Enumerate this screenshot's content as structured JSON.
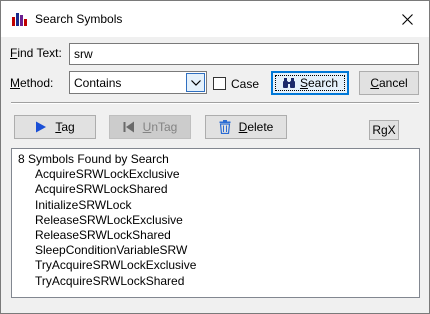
{
  "window": {
    "title": "Search Symbols",
    "app_icon": "bar-chart-icon",
    "close_icon": "close-icon"
  },
  "find": {
    "label_u": "F",
    "label_rest": "ind Text:",
    "value": "srw"
  },
  "method": {
    "label_u": "M",
    "label_rest": "ethod:",
    "selected": "Contains",
    "dropdown_icon": "chevron-down-icon"
  },
  "case_checkbox": {
    "label": "Case",
    "checked": false
  },
  "search_button": {
    "label_u": "S",
    "label_rest": "earch",
    "icon": "binoculars-icon"
  },
  "cancel_button": {
    "label_u": "C",
    "label_rest": "ancel"
  },
  "tag_button": {
    "label_u": "T",
    "label_rest": "ag",
    "icon": "play-arrow-icon"
  },
  "untag_button": {
    "label_u": "U",
    "label_rest": "nTag",
    "icon": "back-arrow-icon",
    "enabled": false
  },
  "delete_button": {
    "label_u": "D",
    "label_rest": "elete",
    "icon": "trash-icon"
  },
  "regex_button": {
    "label": "RgX"
  },
  "results": {
    "header": "8 Symbols Found by Search",
    "items": [
      "AcquireSRWLockExclusive",
      "AcquireSRWLockShared",
      "InitializeSRWLock",
      "ReleaseSRWLockExclusive",
      "ReleaseSRWLockShared",
      "SleepConditionVariableSRW",
      "TryAcquireSRWLockExclusive",
      "TryAcquireSRWLockShared"
    ]
  },
  "colors": {
    "accent": "#0078d7",
    "tag_icon": "#1a4fd6",
    "delete_icon": "#2b6cd4",
    "dialog_bg": "#f0f0f0"
  }
}
